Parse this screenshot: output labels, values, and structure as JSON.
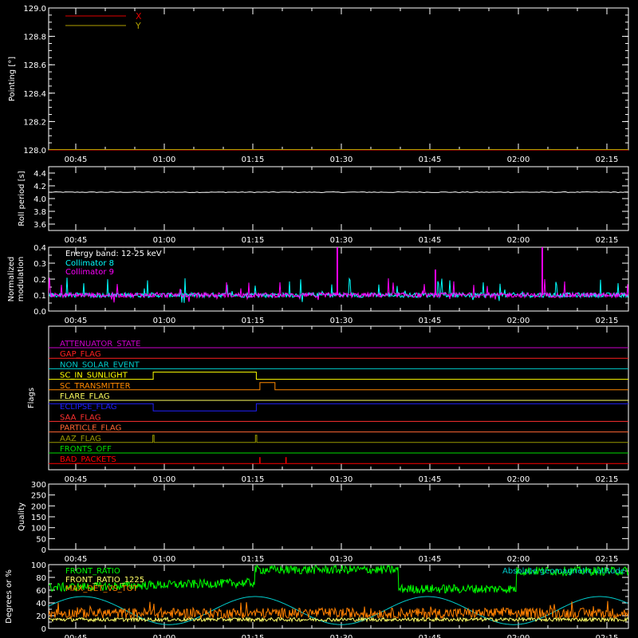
{
  "chart_data": [
    {
      "panel": "pointing",
      "type": "line",
      "ylabel": "Pointing [°]",
      "ylim": [
        128.0,
        129.0
      ],
      "yticks": [
        "128.0",
        "128.2",
        "128.4",
        "128.6",
        "128.8",
        "129.0"
      ],
      "series": [
        {
          "name": "X",
          "color": "#e00000",
          "constant": 128.0
        },
        {
          "name": "Y",
          "color": "#b0a000",
          "constant": 128.0
        }
      ]
    },
    {
      "panel": "roll",
      "type": "line",
      "ylabel": "Roll period [s]",
      "ylim": [
        3.5,
        4.5
      ],
      "yticks": [
        "3.6",
        "3.8",
        "4.0",
        "4.2",
        "4.4"
      ],
      "series": [
        {
          "color": "#ffffff",
          "constant": 4.1
        }
      ]
    },
    {
      "panel": "modulation",
      "type": "line",
      "ylabel_lines": [
        "Normalized",
        "modulation"
      ],
      "ylim": [
        0.0,
        0.4
      ],
      "yticks": [
        "0.0",
        "0.1",
        "0.2",
        "0.3",
        "0.4"
      ],
      "annotation": "Energy band: 12-25 keV",
      "series": [
        {
          "name": "Collimator 8",
          "color": "#00ffff",
          "baseline": 0.1
        },
        {
          "name": "Collimator 9",
          "color": "#ff00ff",
          "baseline": 0.1
        }
      ]
    },
    {
      "panel": "flags",
      "type": "line",
      "ylabel": "Flags",
      "flags": [
        {
          "name": "ATTENUATOR_STATE",
          "color": "#cc00cc",
          "steps": []
        },
        {
          "name": "GAP_FLAG",
          "color": "#ff2020",
          "steps": []
        },
        {
          "name": "NON_SOLAR_EVENT",
          "color": "#00cccc",
          "steps": []
        },
        {
          "name": "SC_IN_SUNLIGHT",
          "color": "#ffff00",
          "steps": [
            [
              0,
              0
            ],
            [
              0.875,
              1
            ],
            [
              2.04,
              0
            ]
          ]
        },
        {
          "name": "SC_TRANSMITTER",
          "color": "#ff8800",
          "steps": [
            [
              0,
              0
            ],
            [
              2.08,
              1
            ],
            [
              2.25,
              0
            ]
          ]
        },
        {
          "name": "FLARE_FLAG",
          "color": "#ffff60",
          "steps": []
        },
        {
          "name": "ECLIPSE_FLAG",
          "color": "#2020ff",
          "steps": [
            [
              0,
              1
            ],
            [
              0.875,
              0
            ],
            [
              2.04,
              1
            ]
          ]
        },
        {
          "name": "SAA_FLAG",
          "color": "#ff3030",
          "steps": []
        },
        {
          "name": "PARTICLE_FLAG",
          "color": "#ff6633",
          "steps": []
        },
        {
          "name": "AAZ_FLAG",
          "color": "#999900",
          "steps": [
            [
              0,
              0
            ],
            [
              0.87,
              1
            ],
            [
              0.885,
              0
            ],
            [
              2.03,
              1
            ],
            [
              2.045,
              0
            ]
          ]
        },
        {
          "name": "FRONTS_OFF",
          "color": "#00dd00",
          "steps": []
        },
        {
          "name": "BAD_PACKETS",
          "color": "#ff0000",
          "spikes": [
            2.08,
            2.375
          ]
        }
      ]
    },
    {
      "panel": "quality",
      "type": "line",
      "ylabel": "Quality",
      "ylim": [
        0,
        300
      ],
      "yticks": [
        "0",
        "50",
        "100",
        "150",
        "200",
        "250",
        "300"
      ],
      "series": [
        {
          "color": "#ffffff",
          "constant": 300
        }
      ]
    },
    {
      "panel": "ratios",
      "type": "line",
      "ylabel": "Degrees or %",
      "ylim": [
        0,
        100
      ],
      "yticks": [
        "0",
        "20",
        "40",
        "60",
        "80",
        "100"
      ],
      "series": [
        {
          "name": "FRONT_RATIO",
          "color": "#00ff00"
        },
        {
          "name": "FRONT_RATIO_1225",
          "color": "#ffff66"
        },
        {
          "name": "MAX_DET_VS_TOT",
          "color": "#ff8000"
        },
        {
          "name": "Absolute geomagnetic latitude",
          "color": "#00cccc"
        }
      ]
    }
  ],
  "x_axis": {
    "tick_labels": [
      "00:45",
      "01:00",
      "01:15",
      "01:30",
      "01:45",
      "02:00",
      "02:15"
    ],
    "minor_per_major": 3
  }
}
